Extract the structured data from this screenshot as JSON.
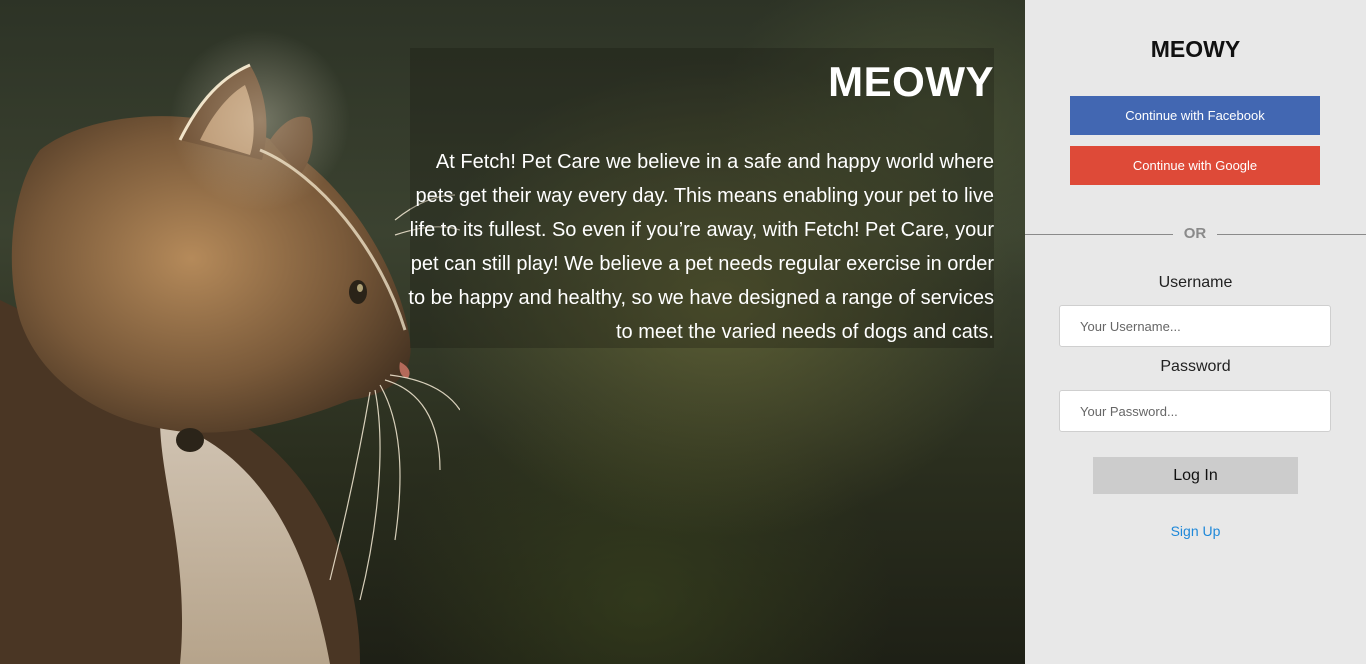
{
  "hero": {
    "title": "MEOWY",
    "description": "At Fetch! Pet Care we believe in a safe and happy world where pets get their way every day. This means enabling your pet to live life to its fullest. So even if you’re away, with Fetch! Pet Care, your pet can still play! We believe a pet needs regular exercise in order to be happy and healthy, so we have designed a range of services to meet the varied needs of dogs and cats.",
    "image_icon": "cat-photo"
  },
  "sidebar": {
    "brand": "MEOWY",
    "facebook_label": "Continue with Facebook",
    "google_label": "Continue with Google",
    "divider_label": "OR",
    "username_label": "Username",
    "username_placeholder": "Your Username...",
    "password_label": "Password",
    "password_placeholder": "Your Password...",
    "login_label": "Log In",
    "signup_label": "Sign Up"
  },
  "colors": {
    "sidebar_bg": "#e8e8e8",
    "facebook": "#4267b2",
    "google": "#de4a38",
    "login_button": "#cccccc",
    "link": "#1e88d9"
  }
}
